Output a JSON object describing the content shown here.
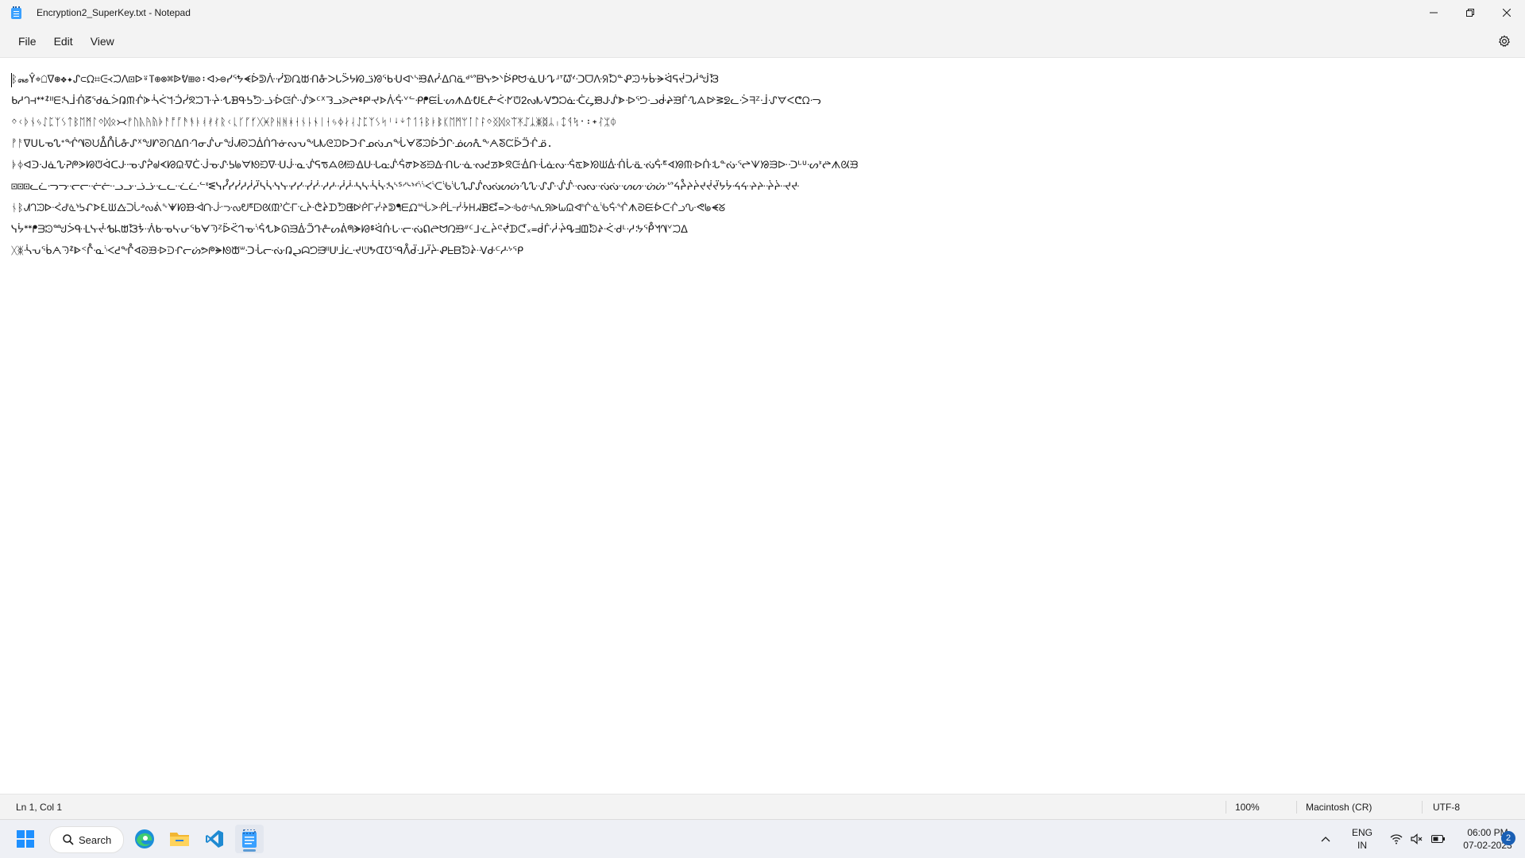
{
  "window": {
    "title": "Encryption2_SuperKey.txt - Notepad"
  },
  "menu": {
    "file": "File",
    "edit": "Edit",
    "view": "View"
  },
  "editor": {
    "lines": [
      "ᛒ꘏Ŷ⌖☖ᐁ⊛❖✦᠌ᔑ⊂ᘯ⌗ᕮ᚜ᙂⴷ⊡ᐅ⍤ⴶ⊕⊗⌘ᐉᕓ⊞⊘᛬ᐊ᚛⊜ᓯᕐᖬᗛᐆᕲᐿᓺᗥᘩᙔᑙᓁᐳᒐᐵᔭᘗᓙᘟᖃᑗᐮᔅᙤᕕᓻᐃᙁᓏᒄᔥᗸᓷᕗᐠᐖᑭᗢᓍᑘᖊᒽᐪᘺᔊᑝᗜᐽᖆᘶᓐᕵᙄᔹᒁᗓᐛᕋᔫᑐᓲᖒᘾ",
      "ᑲᓱᘃ⊣ᕯᙇᐦᗴᔄᒨᑛᘔᖁᓈᐴᕡᙏᒖᗇᔂᐹᖻᑟᓰᘝᙂᒭᔳᐧᖍᗽᑵᕊᘬᓤᐔᙍᒗᔛᗈᑦᕁᘊᓗᐷᖡᙚᒆᔵᗌᐿᕏᘁᓪᑶᖰᙓᒫᔡᗑᐏᕞᘍᓔᑇᖼᙈᒿᔓᗃᐺᕤᘰᓎᑣᖥᙞᒙᔒᗍᐒᕐᘤᓢᑽᖨᙑᒦᔗᗋᐭᕒᘖᓚᑂᖷᙆᒴᔙᗊᐸᕦᘯᓜ",
      "ᛜᚲᚦᚾᛃᛇᛈᛉᛊᛏᛒᛖᛗᛚᛜᛞᛟ᚛᚜ᚠᚢᚣᚤᚥᚧᚨᚩᚪᚫᚬᚭᚮᚯᚰᚱᚲᚳᚴᚵᚶᚷᚸᚹᚺᚻᚼᚽᚾᚿᛀᛁᛂᛃᛄᛅᛆᛇᛈᛉᛊᛋᛌᛍᛎᛏᛐᛑᛒᛓᛔᛕᛖᛗᛘᛙᛚᛛᛜᛝᛞᛟᛠᛡᛢᛣᛤᛥᛦᛧᛨᛩᛪ᛫᛬᛭ᛮᛯᛰ",
      "ᚡᚨᐁᑌᒐᓀᔐᕀᖐᗀᘐᙀᐂᑍᒑᓁᔑᕁᖑᗁᘑᙁᐃᑎᒒᓂᔒᕂᖒᗂᘒᙂᐄᑏᒓᓃᔓᕃᖓᗃᘓᙃᐅᑐᒔᓄᔔᕄᖔᗄᘔᙄᐆᑑᒕᓅᔕᕅᖕᗅᘕᙅᐇᑒᒖᓆ.",
      "ᚧᛄᐊᑔᒘᓈᔘᕈᖘᗈᘘᙈᐋᑕᒙᓉᔙᕉᖙᗉᘙᙉᐌᑖᒚᓊᔚᕊᖚᗊᘚᙊᐍᑗᒛᓋᔛᕋᖛᗋᘛᙋᐎᑘᒜᓌᔜᕌᖜᗌᘜᙌᐏᑙᒝᓍᔝᕍᖝᗍᘝᙍᐐᑚᒞᓎᔞᕎᖞᗎᘞᙎᐑᑛᒟᓏᔟᕏᖟᗏᘟᙏᐒᑜᒠᓐᔠᕐᖠᗐᘠᙐᐓᑝᒡᓑᔡᕑᖡᗑᘡᙑ",
      "⊡⊡⊡ᓚᓛᓜᓝᓞᓟᓠᓡᓢᓣᓤᓥᓦᓧᓨᓩᓪᓫᓬᓭᓮᓯᓰᓱᓲᓳᓴᓵᓶᓷᓸᓹᓺᓻᓼᓽᓾᓿᔀᔁᔂᔃᔄᔅᔆᔇᔈᔉᔊᔋᔌᔍᔎᔏᔐᔑᔒᔓᔔᔕᔖᔗᔘᔙᔚᔛᔜᔝᔞᔟᔠᔡᔢᔣᔤᔥᔦᔧᔨᔩᔪᔫᔬᔭᔮᔯᔰᔱᔲᔳᔴᔵᔶ",
      "ᚾᛒᗂᘃᙄᐅᑆᒇᓈᔉᕊᖋᗌᘍᙎᐏᑐᒑᓒᔓᕔᖕᗖᘗᙘᐙᑚᒛᓜᔝᕞᖟᗠᘡᙢᐣᑤᒥᓦᔧᕨᖩᗪᘫᙬᐭᑮᒯᓰᔱᕲᖳᗴᘵᙶᐷᑸᒹᓺᔻᕼᖽᗾᘿ᐀ᑁᒂᓃᔄᕅᖆᗇᘈᙉᐊᑋᒌᓍᔎᕏᖐᗑᘒᙓᐔᑕᒖᓗᔘᕙᖚᗛᘜ",
      "ᓭᔮᕯᖰᗱᘲᙳᐴᑵᒶᓷᔸᕹᖺᗻᘼᙽᐾᑿᓀᔁᕂᖃᗄᘅᙆᐇᑈᒉᓊᔋᕌᖍᗎᘏᙐᐑᑒᒓᓔᔕᕖᖗᗘᘙᙚᐛᑜᒝᓞᔟᕠᖡᗢᘣᙤᐥᑦᒧᓨᔩᕪᖫᗬᘭ᙮᐀ᑰᒱᓲᔳᕴᖵᗶᘷᙸᐹᑺᒻᓼᔽᕾᖿᗀᘁᙂᐃ",
      "ᚷᛤᔂᕃᖄᗅᘆᙇᐈᑉᒊᓋᔌᕍᖎᗏᘐᙑᐒᑓᒔᓕᔖᕗᖘᗙᘚᙛᐜᑝᒞᓟᔠᕡᖢᗣᘤᙥᐦᑧᒨᓩᔪᕫᖬᗭᘮᙯᐰᑱᒲᓳᔴᕵᖶᗷᘸᙹᐺᑻᒼᓽᔾᕿ"
    ]
  },
  "status": {
    "position": "Ln 1, Col 1",
    "zoom": "100%",
    "line_ending": "Macintosh (CR)",
    "encoding": "UTF-8"
  },
  "taskbar": {
    "search_label": "Search",
    "language_line1": "ENG",
    "language_line2": "IN",
    "time": "06:00 PM",
    "date": "07-02-2023",
    "notification_count": "2"
  }
}
